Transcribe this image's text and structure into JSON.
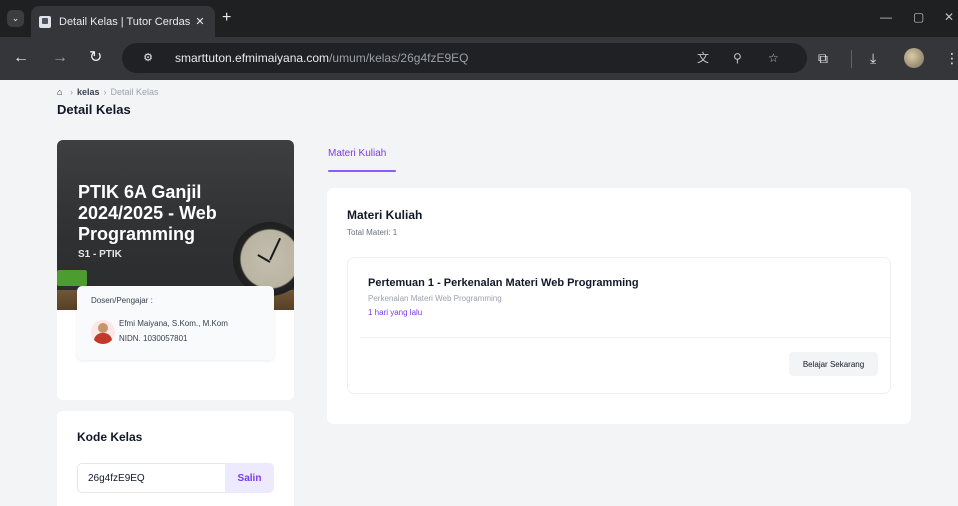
{
  "browser": {
    "tab_title": "Detail Kelas | Tutor Cerdas",
    "url_host": "smarttuton.efmimaiyana.com",
    "url_path": "/umum/kelas/26g4fzE9EQ"
  },
  "breadcrumb": {
    "items": [
      "kelas",
      "Detail Kelas"
    ]
  },
  "page": {
    "title": "Detail Kelas"
  },
  "class_card": {
    "name": "PTIK 6A Ganjil 2024/2025 - Web Programming",
    "program": "S1 - PTIK",
    "lecturer_label": "Dosen/Pengajar :",
    "lecturer_name": "Efmi Maiyana, S.Kom., M.Kom",
    "lecturer_nidn": "NIDN. 1030057801"
  },
  "code_card": {
    "title": "Kode Kelas",
    "code_value": "26g4fzE9EQ",
    "copy_label": "Salin"
  },
  "tabs": {
    "active": "Materi Kuliah"
  },
  "materi": {
    "title": "Materi Kuliah",
    "total": "Total Materi: 1",
    "items": [
      {
        "title": "Pertemuan 1 - Perkenalan Materi Web Programming",
        "description": "Perkenalan Materi Web Programming",
        "time": "1 hari yang lalu",
        "action_label": "Belajar Sekarang"
      }
    ]
  },
  "colors": {
    "accent": "#7c3aed",
    "accent_light": "#ede9fe",
    "browser_dark": "#1f2022",
    "browser_toolbar": "#35363a"
  }
}
